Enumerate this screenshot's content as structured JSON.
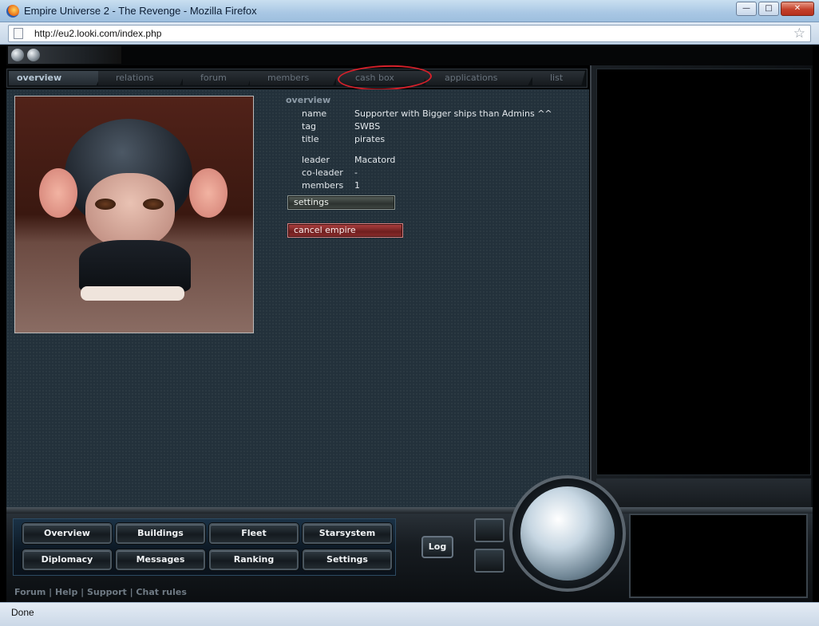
{
  "window": {
    "title": "Empire Universe 2 - The Revenge - Mozilla Firefox",
    "minimize": "—",
    "maximize": "□",
    "close": "✕"
  },
  "navbar": {
    "url": "http://eu2.looki.com/index.php"
  },
  "status": {
    "text": "Done"
  },
  "tabs": [
    {
      "label": "overview",
      "active": true
    },
    {
      "label": "relations"
    },
    {
      "label": "forum"
    },
    {
      "label": "members"
    },
    {
      "label": "cash box",
      "annotated": true
    },
    {
      "label": "applications"
    },
    {
      "label": "list"
    }
  ],
  "overview": {
    "heading": "overview",
    "rows": [
      {
        "label": "name",
        "value": "Supporter with Bigger ships than Admins ^^"
      },
      {
        "label": "tag",
        "value": "SWBS"
      },
      {
        "label": "title",
        "value": "pirates"
      },
      {
        "label": "leader",
        "value": "Macatord"
      },
      {
        "label": "co-leader",
        "value": "-"
      },
      {
        "label": "members",
        "value": "1"
      }
    ],
    "settings_label": "settings",
    "cancel_label": "cancel empire"
  },
  "console": {
    "buttons": [
      "Overview",
      "Buildings",
      "Fleet",
      "Starsystem",
      "Diplomacy",
      "Messages",
      "Ranking",
      "Settings"
    ],
    "log_label": "Log"
  },
  "footer": {
    "links": "Forum | Help | Support | Chat rules"
  },
  "colors": {
    "annotation": "#d5202a",
    "cancel_button": "#8e2d2d",
    "content_bg": "#23313b"
  },
  "icons": {
    "browser": "firefox-icon",
    "bookmark": "star-icon",
    "annotation": "red-circle-annotation"
  }
}
